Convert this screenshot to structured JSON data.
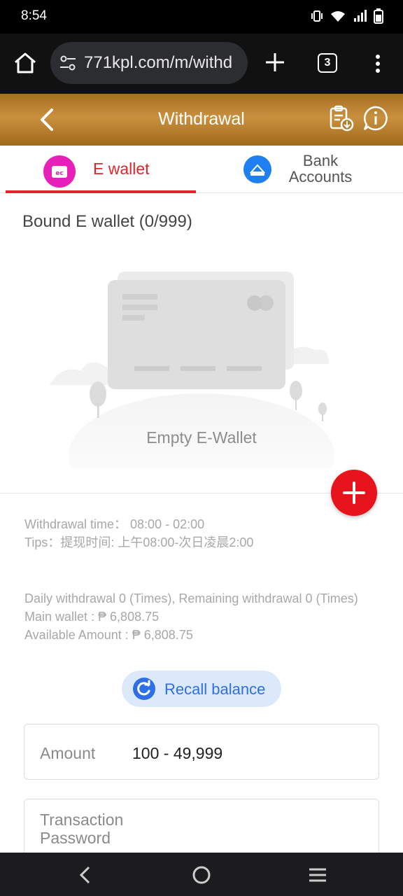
{
  "status_bar": {
    "time": "8:54"
  },
  "browser": {
    "url": "771kpl.com/m/withd",
    "tab_count": "3"
  },
  "header": {
    "title": "Withdrawal"
  },
  "tabs": [
    {
      "label": "E wallet",
      "active": true
    },
    {
      "label": "Bank Accounts",
      "active": false
    }
  ],
  "bound": {
    "title": "Bound E wallet (0/999)"
  },
  "empty": {
    "text": "Empty E-Wallet"
  },
  "info": {
    "withdrawal_time": "Withdrawal time：  08:00 - 02:00",
    "tips": "Tips：提现时间: 上午08:00-次日凌晨2:00",
    "daily": "Daily withdrawal 0 (Times), Remaining withdrawal 0 (Times)",
    "main_wallet": "Main wallet : ₱ 6,808.75",
    "available": "Available Amount : ₱ 6,808.75"
  },
  "recall": {
    "label": "Recall balance"
  },
  "form": {
    "amount_label": "Amount",
    "amount_value": "100 - 49,999",
    "password_label": "Transaction Password"
  },
  "colors": {
    "header_gold": "#b57d2c",
    "active_red": "#e0262a",
    "fab_red": "#e8141d",
    "ewallet_pink": "#e620b8",
    "bank_blue": "#1e7ff0",
    "recall_blue": "#2e6fe3"
  },
  "icons": {
    "back": "chevron-left-icon",
    "record": "clipboard-download-icon",
    "info": "info-bubble-icon",
    "add": "plus-icon",
    "recall": "refresh-icon"
  }
}
